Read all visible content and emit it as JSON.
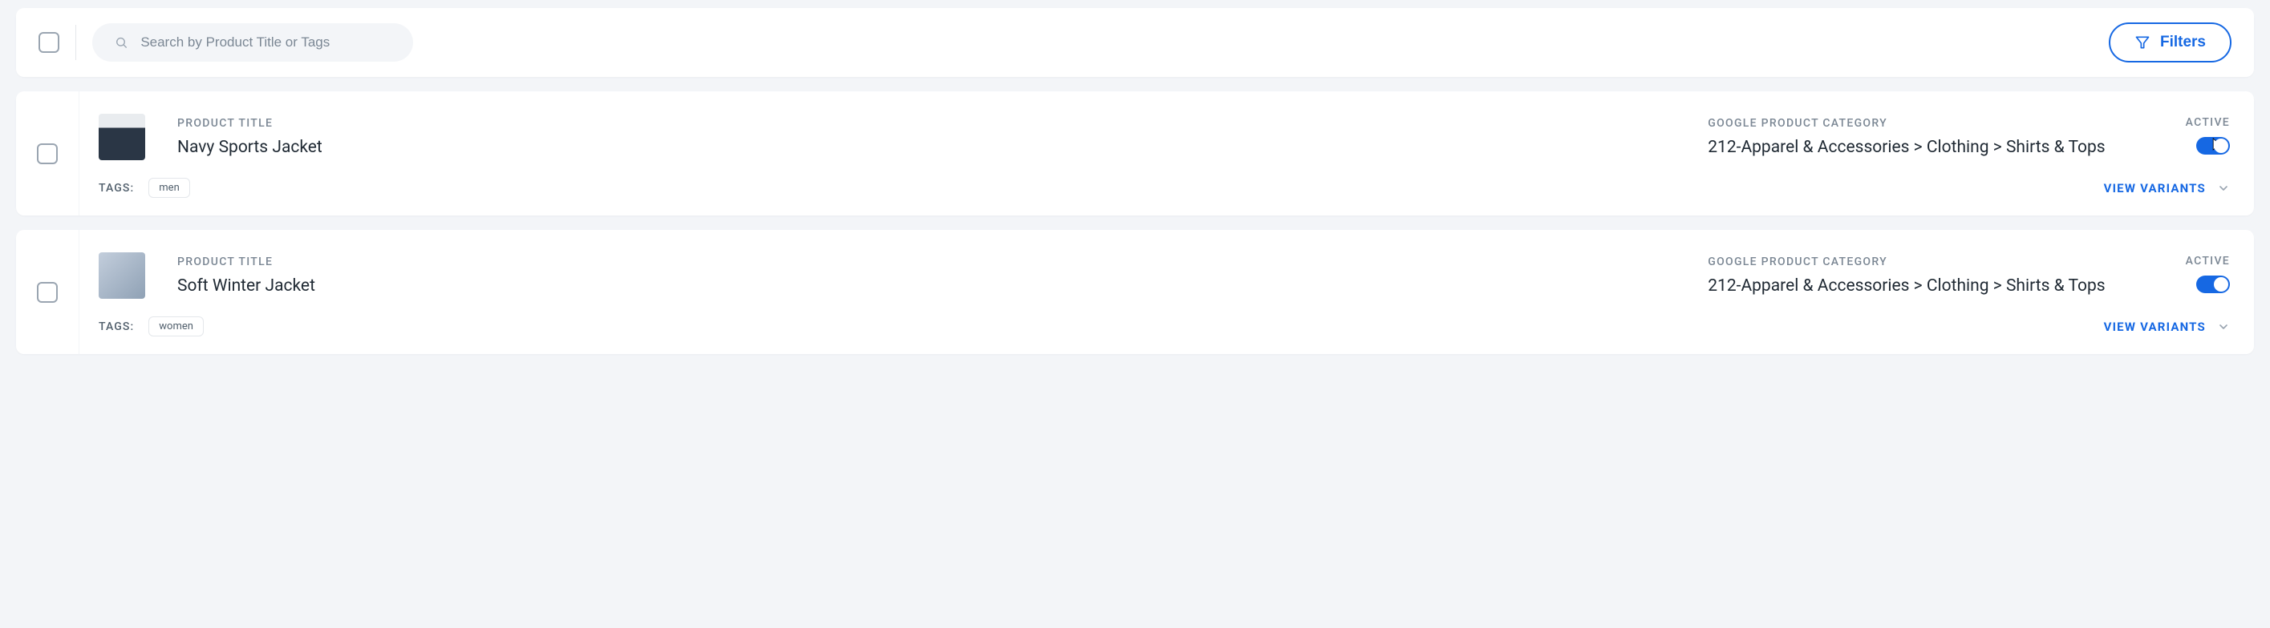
{
  "toolbar": {
    "search_placeholder": "Search by Product Title or Tags",
    "filters_label": "Filters"
  },
  "labels": {
    "product_title": "PRODUCT TITLE",
    "gpc": "GOOGLE PRODUCT CATEGORY",
    "active": "ACTIVE",
    "tags": "TAGS:",
    "view_variants": "VIEW VARIANTS"
  },
  "products": [
    {
      "title": "Navy Sports Jacket",
      "gpc": "212-Apparel & Accessories > Clothing > Shirts & Tops",
      "active": true,
      "tags": [
        "men"
      ],
      "cursor_on_toggle": true,
      "thumb_variant": "dark"
    },
    {
      "title": "Soft Winter Jacket",
      "gpc": "212-Apparel & Accessories > Clothing > Shirts & Tops",
      "active": true,
      "tags": [
        "women"
      ],
      "cursor_on_toggle": false,
      "thumb_variant": "light"
    }
  ]
}
